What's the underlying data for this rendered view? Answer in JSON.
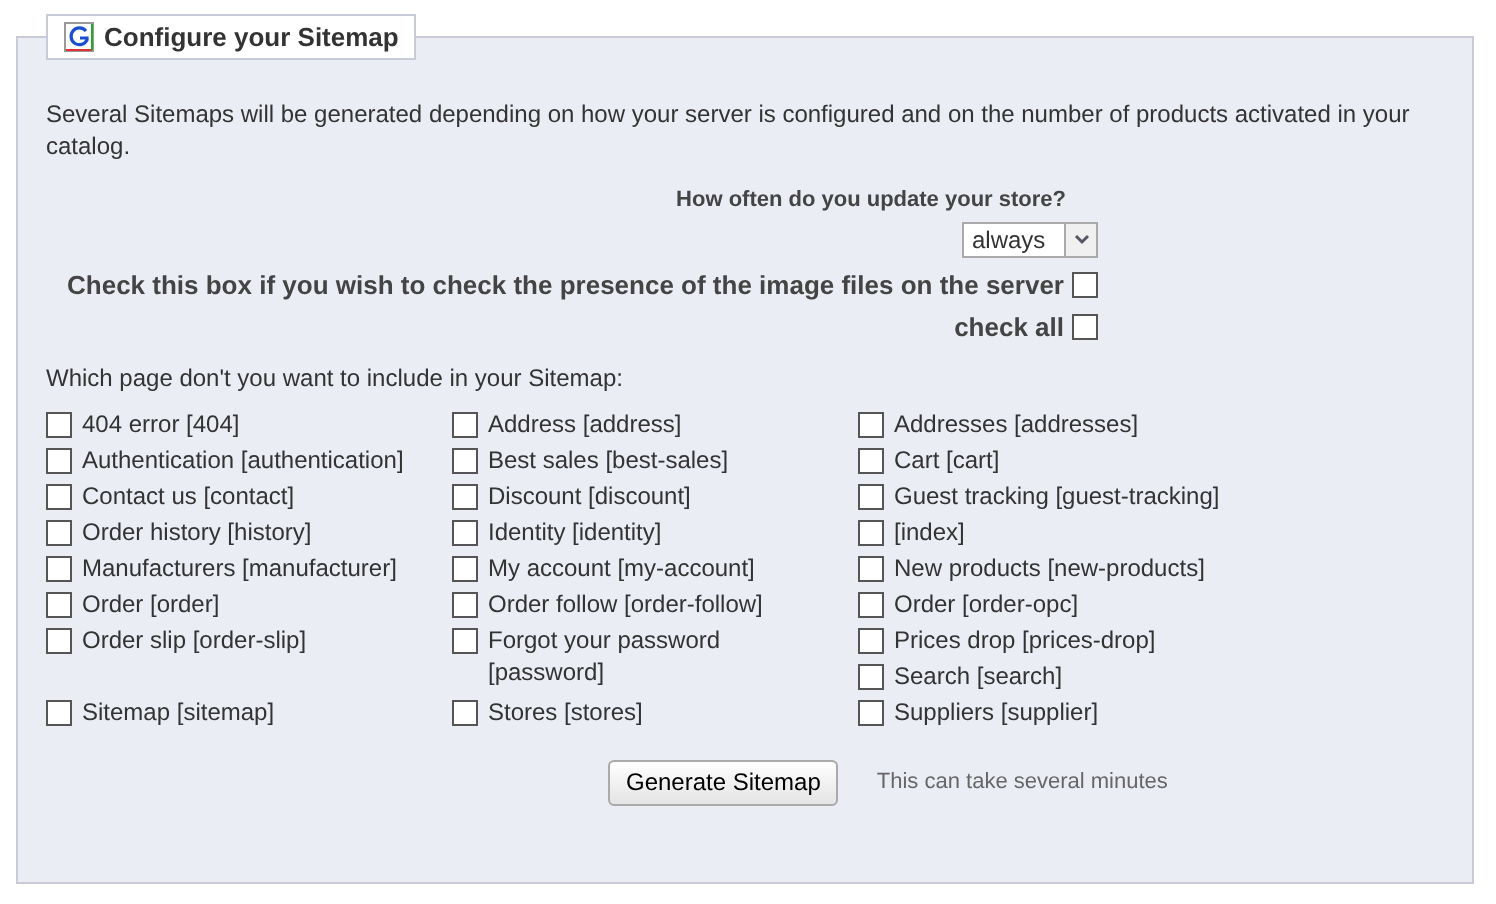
{
  "legend": {
    "title": "Configure your Sitemap"
  },
  "intro": "Several Sitemaps will be generated depending on how your server is configured and on the number of products activated in your catalog.",
  "frequency": {
    "label": "How often do you update your store?",
    "value": "always"
  },
  "image_check": {
    "label": "Check this box if you wish to check the presence of the image files on the server",
    "checked": false
  },
  "check_all": {
    "label": "check all",
    "checked": false
  },
  "pages_heading": "Which page don't you want to include in your Sitemap:",
  "pages": [
    {
      "label": "404 error [404]",
      "checked": false
    },
    {
      "label": "Address [address]",
      "checked": false
    },
    {
      "label": "Addresses [addresses]",
      "checked": false
    },
    {
      "label": "Authentication [authentication]",
      "checked": false
    },
    {
      "label": "Best sales [best-sales]",
      "checked": false
    },
    {
      "label": "Cart [cart]",
      "checked": false
    },
    {
      "label": "Contact us [contact]",
      "checked": false
    },
    {
      "label": "Discount [discount]",
      "checked": false
    },
    {
      "label": "Guest tracking [guest-tracking]",
      "checked": false
    },
    {
      "label": "Order history [history]",
      "checked": false
    },
    {
      "label": "Identity [identity]",
      "checked": false
    },
    {
      "label": "[index]",
      "checked": false
    },
    {
      "label": "Manufacturers [manufacturer]",
      "checked": false
    },
    {
      "label": "My account [my-account]",
      "checked": false
    },
    {
      "label": "New products [new-products]",
      "checked": false
    },
    {
      "label": "Order [order]",
      "checked": false
    },
    {
      "label": "Order follow [order-follow]",
      "checked": false
    },
    {
      "label": "Order [order-opc]",
      "checked": false
    },
    {
      "label": "Order slip [order-slip]",
      "checked": false
    },
    {
      "label": "Forgot your password [password]",
      "checked": false
    },
    {
      "label": "Prices drop [prices-drop]",
      "checked": false
    },
    {
      "label": "Search [search]",
      "checked": false
    },
    {
      "label": "Sitemap [sitemap]",
      "checked": false
    },
    {
      "label": "Stores [stores]",
      "checked": false
    },
    {
      "label": "Suppliers [supplier]",
      "checked": false
    }
  ],
  "generate_button": "Generate Sitemap",
  "generate_note": "This can take several minutes"
}
